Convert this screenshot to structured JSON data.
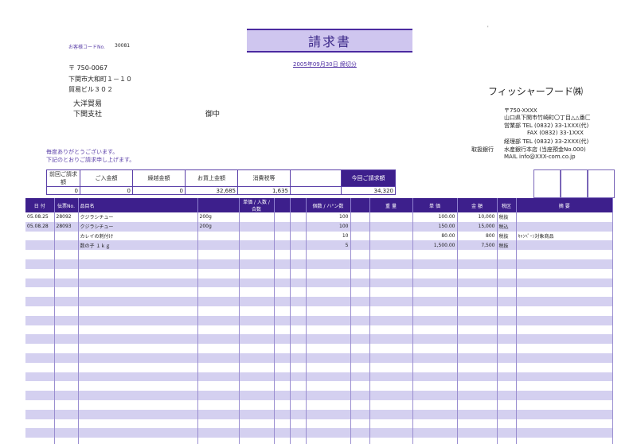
{
  "customer": {
    "code_label": "お客様コードNo.",
    "code": "30081",
    "postal": "〒 750-0067",
    "address1": "下関市大和町１－１０",
    "address2": "貿易ビル３０２",
    "name": "大洋貿易",
    "branch": "下関支社",
    "honorific": "御中"
  },
  "title": "請求書",
  "period": "2005年09月30日 締切分",
  "corner_mark": "'",
  "company": {
    "name": "フィッシャーフード㈱",
    "postal": "〒750-XXXX",
    "address": "山口県下関市竹崎町〇丁目△△番匚",
    "sales_tel": "営業部 TEL (0832) 33-1XXX(代)",
    "sales_fax": "FAX (0832) 33-1XXX",
    "accounting_tel": "経理部 TEL (0832) 33-2XXX(代)",
    "bank_label": "取扱銀行",
    "bank": "水産銀行本店 (当座預金No.000)",
    "mail": "MAIL info@XXX-com.co.jp"
  },
  "greeting": {
    "line1": "毎度ありがとうございます。",
    "line2": "下記のとおりご請求申し上げます。"
  },
  "summary": {
    "headers": [
      "前回ご請求額",
      "ご入金額",
      "繰越金額",
      "お買上金額",
      "消費税等",
      "",
      "今回ご請求額"
    ],
    "values": [
      "0",
      "0",
      "0",
      "32,685",
      "1,635",
      "",
      "34,320"
    ]
  },
  "detail": {
    "headers": [
      "日 付",
      "伝票No.",
      "品目名",
      "",
      "単価 / 入数 / 合数",
      "",
      "",
      "個数 / ハ°ン数",
      "",
      "重 量",
      "単 価",
      "金 額",
      "税区",
      "摘 要"
    ],
    "rows": [
      [
        "05.08.25",
        "28092",
        "クジラシチュー",
        "200g",
        "",
        "",
        "",
        "100",
        "",
        "",
        "100.00",
        "10,000",
        "税抜",
        ""
      ],
      [
        "05.08.28",
        "28093",
        "クジラシチュー",
        "200g",
        "",
        "",
        "",
        "100",
        "",
        "",
        "150.00",
        "15,000",
        "税込",
        ""
      ],
      [
        "",
        "",
        "カレイの刺付け",
        "",
        "",
        "",
        "",
        "10",
        "",
        "",
        "80.00",
        "800",
        "税抜",
        "ｷｬﾝﾍﾟｰﾝ対象商品"
      ],
      [
        "",
        "",
        "数の子 １ｋｇ",
        "",
        "",
        "",
        "",
        "5",
        "",
        "",
        "1,500.00",
        "7,500",
        "税抜",
        ""
      ]
    ],
    "blank_rows": 22
  },
  "colors": {
    "header": "#3d1f8c",
    "stripe": "#d4d0f0",
    "title_fill": "#cfc6ef"
  }
}
